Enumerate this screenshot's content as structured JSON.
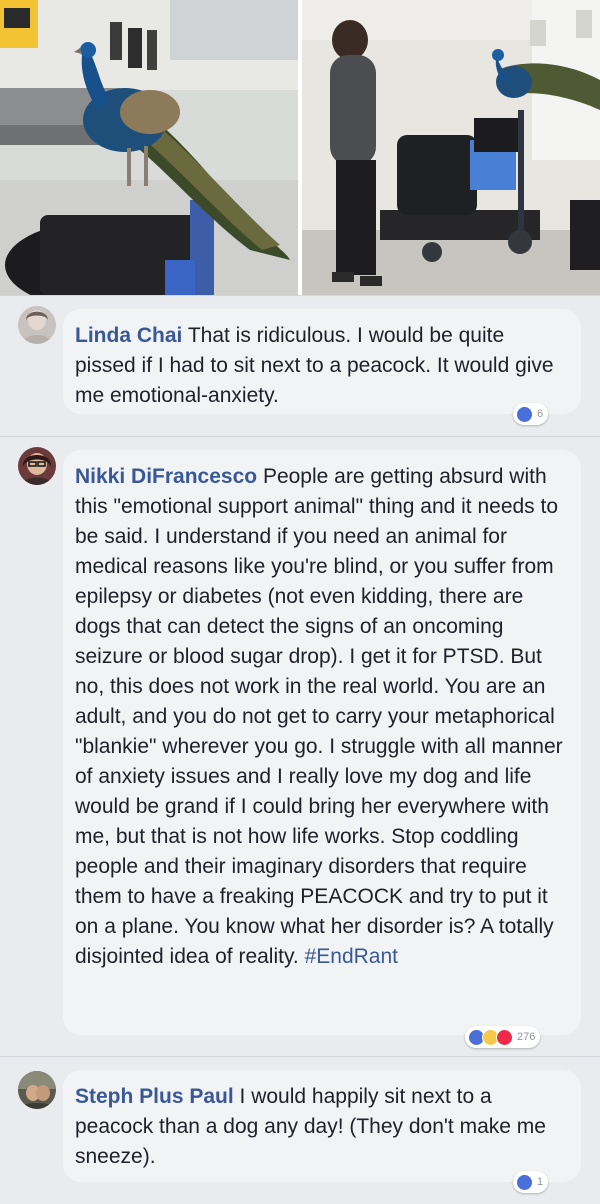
{
  "comments": [
    {
      "author": "Linda Chai",
      "text": "That is ridiculous. I would be quite pissed if I had to sit next to a peacock. It would give me emotional-anxiety.",
      "hashtag": "",
      "reactions": {
        "icons": [
          "like-icon"
        ],
        "count": "6"
      },
      "colors": {
        "avatar": "#c9c3c0"
      }
    },
    {
      "author": "Nikki DiFrancesco",
      "text": "People are getting absurd with this \"emotional support animal\" thing and it needs to be said. I understand if you need an animal for medical reasons like you're blind, or you suffer from epilepsy or diabetes (not even kidding, there are dogs that can detect the signs of an oncoming seizure or blood sugar drop). I get it for PTSD. But no, this does not work in the real world. You are an adult, and you do not get to carry your metaphorical \"blankie\" wherever you go. I struggle with all manner of anxiety issues and I really love my dog and life would be grand if I could bring her everywhere with me, but that is not how life works. Stop coddling people and their imaginary disorders that require them to have a freaking PEACOCK and try to put it on a plane. You know what her disorder is? A totally disjointed idea of reality.",
      "hashtag": "#EndRant",
      "reactions": {
        "icons": [
          "like-icon",
          "wow-icon",
          "love-icon"
        ],
        "count": "276"
      },
      "colors": {
        "avatar": "#6a3b3a"
      }
    },
    {
      "author": "Steph Plus Paul",
      "text": "I would happily sit next to a peacock than a dog any day! (They don't make me sneeze).",
      "hashtag": "",
      "reactions": {
        "icons": [
          "like-icon"
        ],
        "count": "1"
      },
      "colors": {
        "avatar": "#5b5a4e"
      }
    }
  ],
  "colors": {
    "author_link": "#385898",
    "bubble": "#f2f3f5",
    "background": "#e9ebee",
    "like": "#4a6fd8"
  }
}
